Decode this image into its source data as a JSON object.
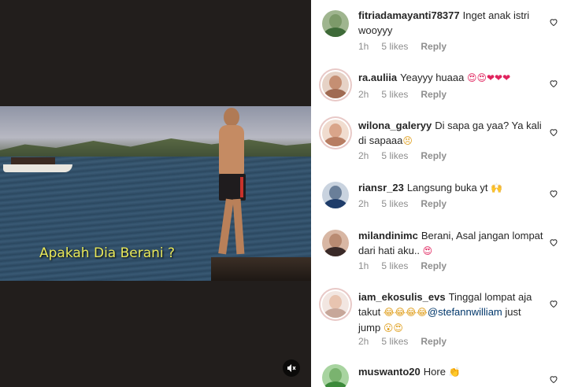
{
  "video": {
    "caption": "Apakah Dia Berani ?",
    "mute_icon": "speaker-muted-icon"
  },
  "comments": [
    {
      "username": "fitriadamayanti78377",
      "text": "Inget anak istri wooyyy",
      "emoji": "",
      "time": "1h",
      "likes": "5 likes",
      "reply": "Reply",
      "avatar_color": "#5a7a50",
      "story_ring": false
    },
    {
      "username": "ra.auliia",
      "text": "Yeayyy huaaa",
      "emoji": "😍😍❤❤❤",
      "time": "2h",
      "likes": "5 likes",
      "reply": "Reply",
      "avatar_color": "#c58f73",
      "story_ring": true
    },
    {
      "username": "wilona_galeryy",
      "text": "Di sapa ga yaa? Ya kali di sapaaa",
      "emoji": "😣",
      "time": "2h",
      "likes": "5 likes",
      "reply": "Reply",
      "avatar_color": "#d9a58a",
      "story_ring": true
    },
    {
      "username": "riansr_23",
      "text": "Langsung buka yt",
      "emoji": "🙌",
      "time": "2h",
      "likes": "5 likes",
      "reply": "Reply",
      "avatar_color": "#1f3d6a",
      "story_ring": false
    },
    {
      "username": "milandinimc",
      "text": "Berani, Asal jangan lompat dari hati aku..",
      "emoji": "😍",
      "time": "1h",
      "likes": "5 likes",
      "reply": "Reply",
      "avatar_color": "#3a2a28",
      "story_ring": false
    },
    {
      "username": "iam_ekosulis_evs",
      "text": "Tinggal lompat aja takut",
      "emoji": "😂😂😂😂",
      "mention": "@stefannwilliam",
      "text2": "just jump",
      "emoji2": "😮😍",
      "time": "2h",
      "likes": "5 likes",
      "reply": "Reply",
      "avatar_color": "#e8d0c8",
      "story_ring": true
    },
    {
      "username": "muswanto20",
      "text": "Hore",
      "emoji": "👏",
      "time": "",
      "likes": "",
      "reply": "",
      "avatar_color": "#3c8a3a",
      "story_ring": false
    }
  ],
  "icons": {
    "like": "heart-outline-icon"
  }
}
